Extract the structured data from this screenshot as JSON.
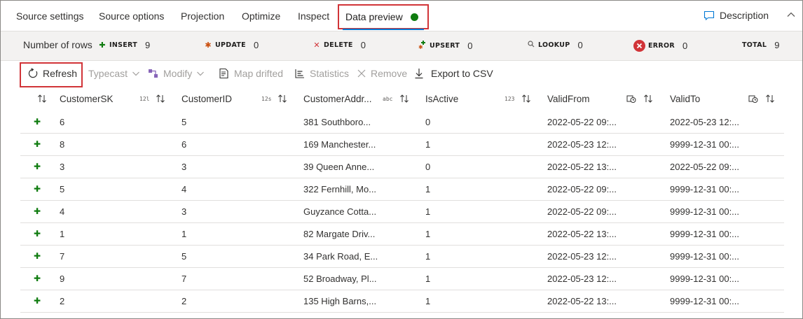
{
  "tabs": [
    {
      "label": "Source settings"
    },
    {
      "label": "Source options"
    },
    {
      "label": "Projection"
    },
    {
      "label": "Optimize"
    },
    {
      "label": "Inspect"
    },
    {
      "label": "Data preview",
      "active": true
    }
  ],
  "description_label": "Description",
  "counts": {
    "title": "Number of rows",
    "stats": [
      {
        "name": "INSERT",
        "value": "9",
        "icon": "plus-icon",
        "color": "#107c10"
      },
      {
        "name": "UPDATE",
        "value": "0",
        "icon": "asterisk-icon",
        "color": "#ca5010"
      },
      {
        "name": "DELETE",
        "value": "0",
        "icon": "x-icon",
        "color": "#d13438"
      },
      {
        "name": "UPSERT",
        "value": "0",
        "icon": "upsert-icon",
        "color": "#107c10"
      },
      {
        "name": "LOOKUP",
        "value": "0",
        "icon": "search-icon",
        "color": "#605e5c"
      },
      {
        "name": "ERROR",
        "value": "0",
        "icon": "error-icon",
        "color": "#d13438"
      },
      {
        "name": "TOTAL",
        "value": "9",
        "icon": "",
        "color": "#201f1e"
      }
    ]
  },
  "toolbar": {
    "refresh": "Refresh",
    "typecast": "Typecast",
    "modify": "Modify",
    "map_drifted": "Map drifted",
    "statistics": "Statistics",
    "remove": "Remove",
    "export": "Export to CSV"
  },
  "table": {
    "columns": [
      {
        "name": "CustomerSK",
        "type": "12l"
      },
      {
        "name": "CustomerID",
        "type": "12s"
      },
      {
        "name": "CustomerAddr...",
        "type": "abc"
      },
      {
        "name": "IsActive",
        "type": "123"
      },
      {
        "name": "ValidFrom",
        "type": "datetime-icon"
      },
      {
        "name": "ValidTo",
        "type": "datetime-icon"
      }
    ],
    "rows": [
      [
        "6",
        "5",
        "381 Southboro...",
        "0",
        "2022-05-22 09:...",
        "2022-05-23 12:..."
      ],
      [
        "8",
        "6",
        "169 Manchester...",
        "1",
        "2022-05-23 12:...",
        "9999-12-31 00:..."
      ],
      [
        "3",
        "3",
        "39 Queen Anne...",
        "0",
        "2022-05-22 13:...",
        "2022-05-22 09:..."
      ],
      [
        "5",
        "4",
        "322 Fernhill, Mo...",
        "1",
        "2022-05-22 09:...",
        "9999-12-31 00:..."
      ],
      [
        "4",
        "3",
        "Guyzance Cotta...",
        "1",
        "2022-05-22 09:...",
        "9999-12-31 00:..."
      ],
      [
        "1",
        "1",
        "82 Margate Driv...",
        "1",
        "2022-05-22 13:...",
        "9999-12-31 00:..."
      ],
      [
        "7",
        "5",
        "34 Park Road, E...",
        "1",
        "2022-05-23 12:...",
        "9999-12-31 00:..."
      ],
      [
        "9",
        "7",
        "52 Broadway, Pl...",
        "1",
        "2022-05-23 12:...",
        "9999-12-31 00:..."
      ],
      [
        "2",
        "2",
        "135 High Barns,...",
        "1",
        "2022-05-22 13:...",
        "9999-12-31 00:..."
      ]
    ]
  }
}
